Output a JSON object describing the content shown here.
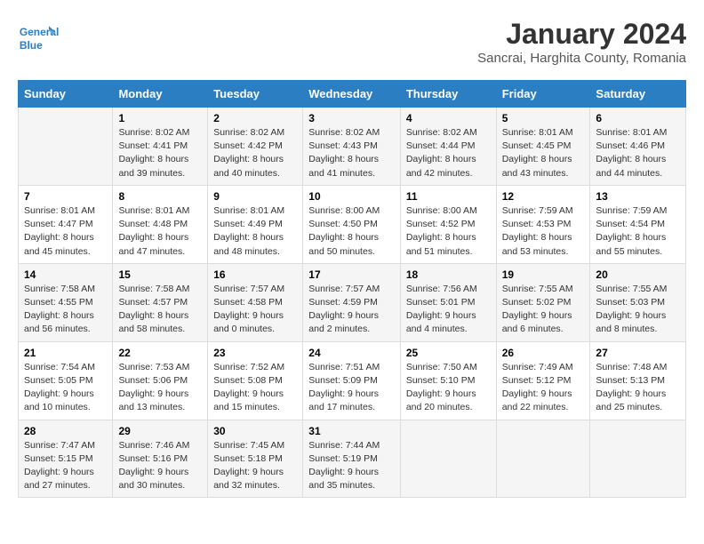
{
  "header": {
    "logo_line1": "General",
    "logo_line2": "Blue",
    "month": "January 2024",
    "location": "Sancrai, Harghita County, Romania"
  },
  "weekdays": [
    "Sunday",
    "Monday",
    "Tuesday",
    "Wednesday",
    "Thursday",
    "Friday",
    "Saturday"
  ],
  "weeks": [
    [
      {
        "day": "",
        "sunrise": "",
        "sunset": "",
        "daylight": ""
      },
      {
        "day": "1",
        "sunrise": "8:02 AM",
        "sunset": "4:41 PM",
        "daylight": "8 hours and 39 minutes."
      },
      {
        "day": "2",
        "sunrise": "8:02 AM",
        "sunset": "4:42 PM",
        "daylight": "8 hours and 40 minutes."
      },
      {
        "day": "3",
        "sunrise": "8:02 AM",
        "sunset": "4:43 PM",
        "daylight": "8 hours and 41 minutes."
      },
      {
        "day": "4",
        "sunrise": "8:02 AM",
        "sunset": "4:44 PM",
        "daylight": "8 hours and 42 minutes."
      },
      {
        "day": "5",
        "sunrise": "8:01 AM",
        "sunset": "4:45 PM",
        "daylight": "8 hours and 43 minutes."
      },
      {
        "day": "6",
        "sunrise": "8:01 AM",
        "sunset": "4:46 PM",
        "daylight": "8 hours and 44 minutes."
      }
    ],
    [
      {
        "day": "7",
        "sunrise": "8:01 AM",
        "sunset": "4:47 PM",
        "daylight": "8 hours and 45 minutes."
      },
      {
        "day": "8",
        "sunrise": "8:01 AM",
        "sunset": "4:48 PM",
        "daylight": "8 hours and 47 minutes."
      },
      {
        "day": "9",
        "sunrise": "8:01 AM",
        "sunset": "4:49 PM",
        "daylight": "8 hours and 48 minutes."
      },
      {
        "day": "10",
        "sunrise": "8:00 AM",
        "sunset": "4:50 PM",
        "daylight": "8 hours and 50 minutes."
      },
      {
        "day": "11",
        "sunrise": "8:00 AM",
        "sunset": "4:52 PM",
        "daylight": "8 hours and 51 minutes."
      },
      {
        "day": "12",
        "sunrise": "7:59 AM",
        "sunset": "4:53 PM",
        "daylight": "8 hours and 53 minutes."
      },
      {
        "day": "13",
        "sunrise": "7:59 AM",
        "sunset": "4:54 PM",
        "daylight": "8 hours and 55 minutes."
      }
    ],
    [
      {
        "day": "14",
        "sunrise": "7:58 AM",
        "sunset": "4:55 PM",
        "daylight": "8 hours and 56 minutes."
      },
      {
        "day": "15",
        "sunrise": "7:58 AM",
        "sunset": "4:57 PM",
        "daylight": "8 hours and 58 minutes."
      },
      {
        "day": "16",
        "sunrise": "7:57 AM",
        "sunset": "4:58 PM",
        "daylight": "9 hours and 0 minutes."
      },
      {
        "day": "17",
        "sunrise": "7:57 AM",
        "sunset": "4:59 PM",
        "daylight": "9 hours and 2 minutes."
      },
      {
        "day": "18",
        "sunrise": "7:56 AM",
        "sunset": "5:01 PM",
        "daylight": "9 hours and 4 minutes."
      },
      {
        "day": "19",
        "sunrise": "7:55 AM",
        "sunset": "5:02 PM",
        "daylight": "9 hours and 6 minutes."
      },
      {
        "day": "20",
        "sunrise": "7:55 AM",
        "sunset": "5:03 PM",
        "daylight": "9 hours and 8 minutes."
      }
    ],
    [
      {
        "day": "21",
        "sunrise": "7:54 AM",
        "sunset": "5:05 PM",
        "daylight": "9 hours and 10 minutes."
      },
      {
        "day": "22",
        "sunrise": "7:53 AM",
        "sunset": "5:06 PM",
        "daylight": "9 hours and 13 minutes."
      },
      {
        "day": "23",
        "sunrise": "7:52 AM",
        "sunset": "5:08 PM",
        "daylight": "9 hours and 15 minutes."
      },
      {
        "day": "24",
        "sunrise": "7:51 AM",
        "sunset": "5:09 PM",
        "daylight": "9 hours and 17 minutes."
      },
      {
        "day": "25",
        "sunrise": "7:50 AM",
        "sunset": "5:10 PM",
        "daylight": "9 hours and 20 minutes."
      },
      {
        "day": "26",
        "sunrise": "7:49 AM",
        "sunset": "5:12 PM",
        "daylight": "9 hours and 22 minutes."
      },
      {
        "day": "27",
        "sunrise": "7:48 AM",
        "sunset": "5:13 PM",
        "daylight": "9 hours and 25 minutes."
      }
    ],
    [
      {
        "day": "28",
        "sunrise": "7:47 AM",
        "sunset": "5:15 PM",
        "daylight": "9 hours and 27 minutes."
      },
      {
        "day": "29",
        "sunrise": "7:46 AM",
        "sunset": "5:16 PM",
        "daylight": "9 hours and 30 minutes."
      },
      {
        "day": "30",
        "sunrise": "7:45 AM",
        "sunset": "5:18 PM",
        "daylight": "9 hours and 32 minutes."
      },
      {
        "day": "31",
        "sunrise": "7:44 AM",
        "sunset": "5:19 PM",
        "daylight": "9 hours and 35 minutes."
      },
      {
        "day": "",
        "sunrise": "",
        "sunset": "",
        "daylight": ""
      },
      {
        "day": "",
        "sunrise": "",
        "sunset": "",
        "daylight": ""
      },
      {
        "day": "",
        "sunrise": "",
        "sunset": "",
        "daylight": ""
      }
    ]
  ]
}
